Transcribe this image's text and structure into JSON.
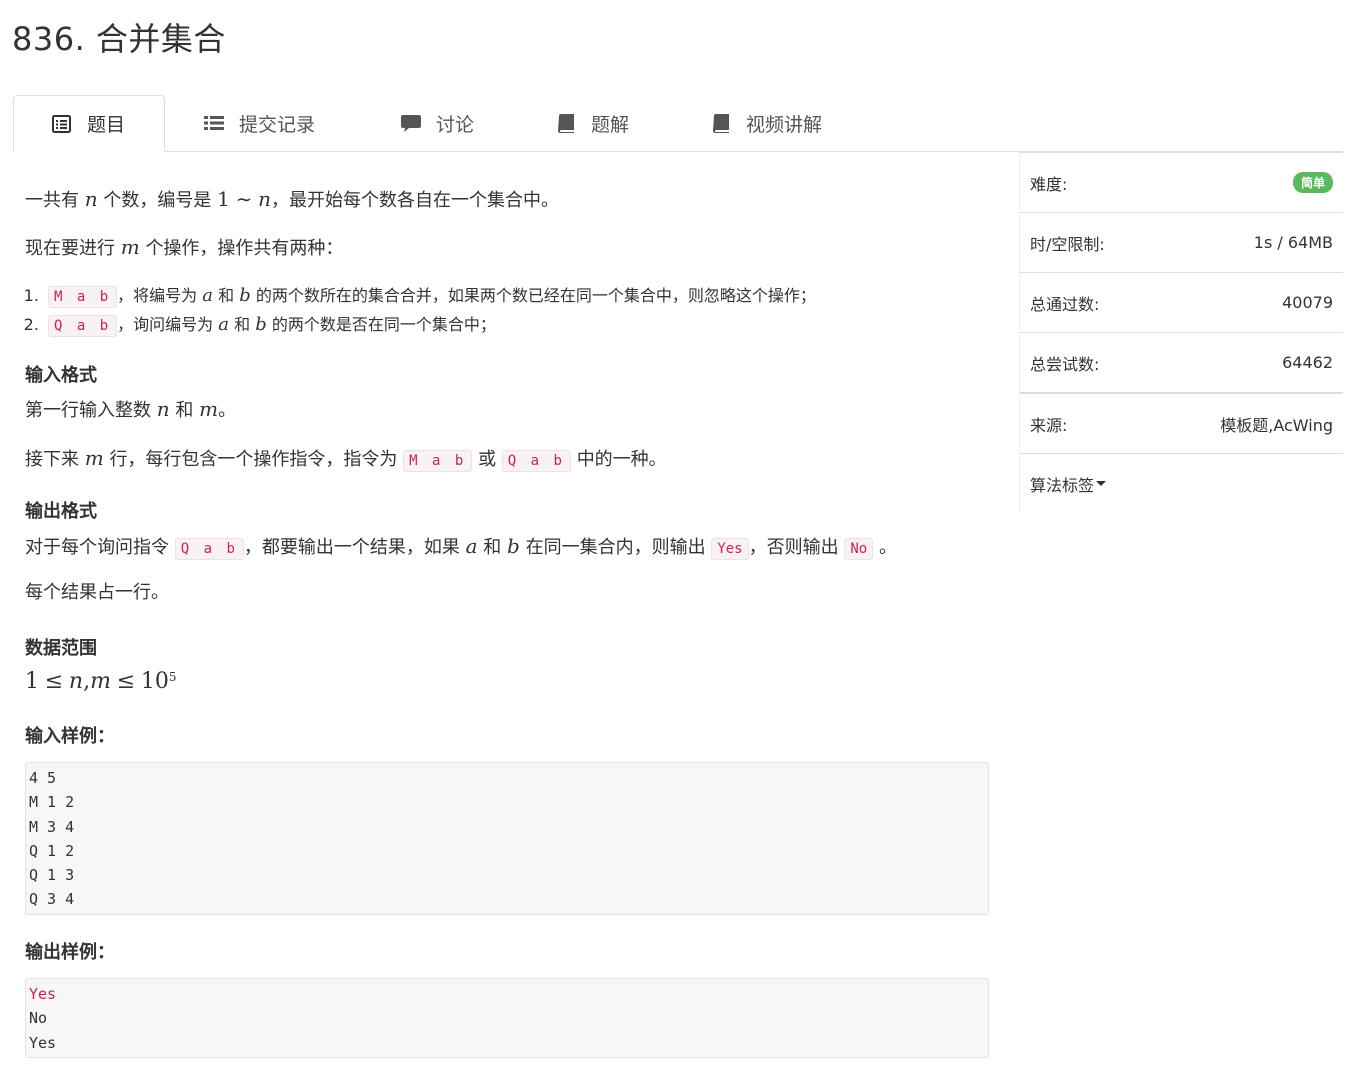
{
  "problem": {
    "title": "836. 合并集合"
  },
  "tabs": [
    {
      "label": "题目",
      "icon": "list-alt-icon"
    },
    {
      "label": "提交记录",
      "icon": "list-icon"
    },
    {
      "label": "讨论",
      "icon": "comment-icon"
    },
    {
      "label": "题解",
      "icon": "book-icon"
    },
    {
      "label": "视频讲解",
      "icon": "book-icon"
    }
  ],
  "sidebar": {
    "difficulty_label": "难度:",
    "difficulty_value": "简单",
    "difficulty_color": "#5cb85c",
    "limit_label": "时/空限制:",
    "limit_value": "1s / 64MB",
    "passed_label": "总通过数:",
    "passed_value": "40079",
    "tried_label": "总尝试数:",
    "tried_value": "64462",
    "source_label": "来源:",
    "source_value": "模板题,AcWing",
    "tags_label": "算法标签"
  },
  "desc": {
    "p1_a": "一共有",
    "p1_n": "n",
    "p1_b": "个数，编号是",
    "p1_one": "1",
    "p1_tilde": "∼",
    "p1_n2": "n",
    "p1_c": "，最开始每个数各自在一个集合中。",
    "p2_a": "现在要进行",
    "p2_m": "m",
    "p2_b": "个操作，操作共有两种：",
    "op1_code": "M a b",
    "op1_a": "，将编号为",
    "op1_va": "a",
    "op1_b": "和",
    "op1_vb": "b",
    "op1_c": "的两个数所在的集合合并，如果两个数已经在同一个集合中，则忽略这个操作；",
    "op2_code": "Q a b",
    "op2_a": "，询问编号为",
    "op2_va": "a",
    "op2_b": "和",
    "op2_vb": "b",
    "op2_c": "的两个数是否在同一个集合中；"
  },
  "input_format": {
    "heading": "输入格式",
    "l1_a": "第一行输入整数",
    "l1_n": "n",
    "l1_b": "和",
    "l1_m": "m",
    "l1_c": "。",
    "l2_a": "接下来",
    "l2_m": "m",
    "l2_b": "行，每行包含一个操作指令，指令为",
    "l2_code1": "M a b",
    "l2_c": "或",
    "l2_code2": "Q a b",
    "l2_d": "中的一种。"
  },
  "output_format": {
    "heading": "输出格式",
    "l1_a": "对于每个询问指令",
    "l1_code": "Q a b",
    "l1_b": "，都要输出一个结果，如果",
    "l1_va": "a",
    "l1_c": "和",
    "l1_vb": "b",
    "l1_d": "在同一集合内，则输出",
    "l1_yes": "Yes",
    "l1_e": "，否则输出",
    "l1_no": "No",
    "l1_f": "。",
    "l2": "每个结果占一行。"
  },
  "range": {
    "heading": "数据范围",
    "one": "1",
    "le1": "≤",
    "n": "n",
    "comma": ",",
    "m": "m",
    "le2": "≤",
    "ten": "10",
    "exp": "5"
  },
  "sample_input": {
    "heading": "输入样例：",
    "lines": [
      "4 5",
      "M 1 2",
      "M 3 4",
      "Q 1 2",
      "Q 1 3",
      "Q 3 4"
    ]
  },
  "sample_output": {
    "heading": "输出样例：",
    "lines": [
      "Yes",
      "No",
      "Yes"
    ]
  }
}
